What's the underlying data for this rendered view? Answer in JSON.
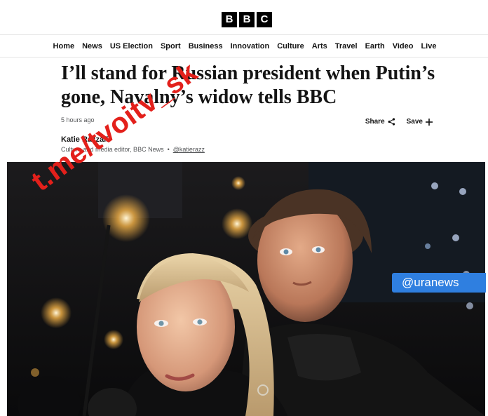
{
  "brand": {
    "logo_letters": [
      "B",
      "B",
      "C"
    ]
  },
  "nav": {
    "items": [
      "Home",
      "News",
      "US Election",
      "Sport",
      "Business",
      "Innovation",
      "Culture",
      "Arts",
      "Travel",
      "Earth",
      "Video",
      "Live"
    ]
  },
  "article": {
    "headline": "I’ll stand for Russian president when Putin’s gone, Navalny’s widow tells BBC",
    "timestamp": "5 hours ago",
    "share_label": "Share",
    "save_label": "Save",
    "author_name": "Katie Razzall",
    "author_role": "Culture and media editor, BBC News",
    "author_handle": "@katierazz"
  },
  "image_overlay": {
    "agency_tag": "@uranews"
  },
  "watermark": {
    "text": "t.me/tvoitv_sk",
    "color": "#e3201b"
  },
  "colors": {
    "ura_blue": "#2f7fe0",
    "text": "#141414",
    "muted": "#545658"
  },
  "icons": {
    "share": "share-icon",
    "save": "plus-icon"
  }
}
